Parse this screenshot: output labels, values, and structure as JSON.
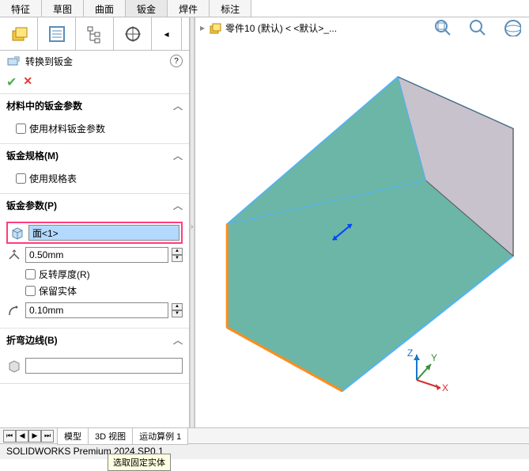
{
  "top_tabs": [
    "特征",
    "草图",
    "曲面",
    "钣金",
    "焊件",
    "标注"
  ],
  "active_top_tab": "钣金",
  "feature": {
    "title": "转换到钣金",
    "help": "?"
  },
  "tree_item": "零件10 (默认) < <默认>_...",
  "sections": {
    "material": {
      "title": "材料中的钣金参数",
      "use_material": "使用材料钣金参数"
    },
    "gauge": {
      "title": "钣金规格(M)",
      "use_gauge_table": "使用规格表"
    },
    "params": {
      "title": "钣金参数(P)",
      "face_value": "面<1>",
      "tooltip": "选取固定实体",
      "thickness": "0.50mm",
      "reverse_thickness": "反转厚度(R)",
      "keep_body": "保留实体",
      "bend_radius": "0.10mm"
    },
    "bend_edges": {
      "title": "折弯边线(B)"
    }
  },
  "bottom_tabs": [
    "模型",
    "3D 视图",
    "运动算例 1"
  ],
  "status": "SOLIDWORKS Premium 2024 SP0.1",
  "axes": {
    "x": "X",
    "y": "Y",
    "z": "Z"
  }
}
